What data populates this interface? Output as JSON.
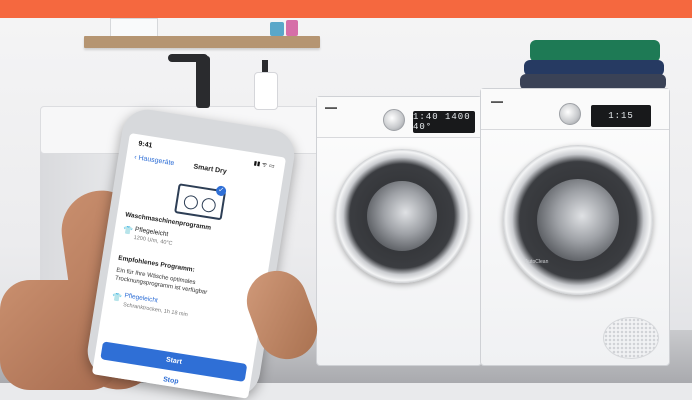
{
  "phone": {
    "status_time": "9:41",
    "status_icons": "▮▮ ᯤ ▭",
    "back_label": "‹ Hausgeräte",
    "screen_title": "Smart Dry",
    "section1_title": "Waschmaschinenprogramm",
    "program_name": "Pflegeleicht",
    "program_detail": "1200 U/m, 40°C",
    "section2_title": "Empfohlenes Programm:",
    "recommend_text": "Ein für Ihre Wäsche optimales Trocknungsprogramm ist verfügbar",
    "recommend_program": "Pflegeleicht",
    "recommend_detail": "Schranktrocken, 1h 18 min",
    "start_label": "Start",
    "stop_label": "Stop"
  },
  "washer": {
    "display": "1:40 1400 40°"
  },
  "dryer": {
    "display": "1:15",
    "door_label": "AutoClean"
  },
  "colors": {
    "banner": "#f5683f",
    "accent": "#2f6fd6"
  }
}
